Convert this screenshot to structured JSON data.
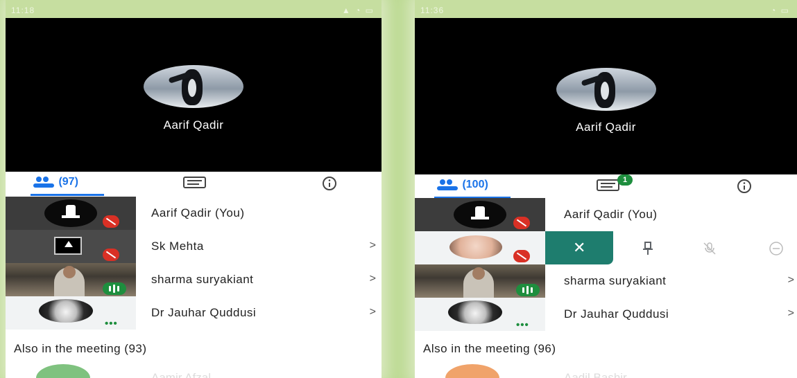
{
  "left": {
    "status_time": "11:18",
    "video_name": "Aarif Qadir",
    "participants_count": "(97)",
    "participants": [
      {
        "name": "Aarif Qadir (You)"
      },
      {
        "name": "Sk Mehta"
      },
      {
        "name": "sharma suryakiant"
      },
      {
        "name": "Dr Jauhar Quddusi"
      }
    ],
    "also_label": "Also in the meeting (93)",
    "next_name": "Aamir Afzal"
  },
  "right": {
    "status_time": "11:36",
    "video_name": "Aarif Qadir",
    "participants_count": "(100)",
    "chat_badge": "1",
    "participants": [
      {
        "name": "Aarif Qadir (You)"
      },
      {
        "name": "sharma suryakiant"
      },
      {
        "name": "Dr Jauhar Quddusi"
      }
    ],
    "also_label": "Also in the meeting (96)",
    "next_name": "Aadil Bashir"
  },
  "chevron": ">",
  "close_glyph": "✕",
  "colors": {
    "accent": "#1a73e8",
    "muted_red": "#d93025",
    "speaking_green": "#1e8e3e",
    "action_teal": "#1e7d6e"
  }
}
